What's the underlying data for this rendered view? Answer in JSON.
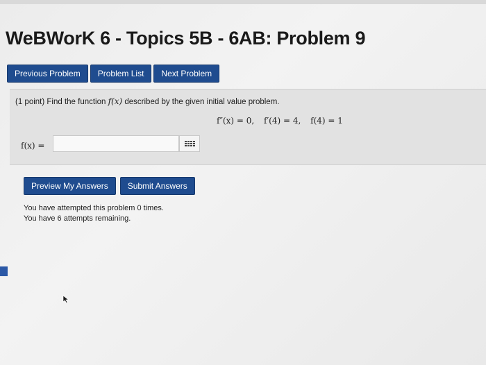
{
  "page": {
    "title": "WeBWorK 6 - Topics 5B - 6AB: Problem 9"
  },
  "nav": {
    "previous_label": "Previous Problem",
    "list_label": "Problem List",
    "next_label": "Next Problem"
  },
  "problem": {
    "intro_before": "(1 point) Find the function ",
    "intro_fx": "f(x)",
    "intro_after": " described by the given initial value problem.",
    "conditions": [
      "f″(x) = 0,",
      "f′(4) = 4,",
      "f(4) = 1"
    ],
    "answer_label": "f(x) =",
    "answer_value": ""
  },
  "actions": {
    "preview_label": "Preview My Answers",
    "submit_label": "Submit Answers"
  },
  "status": {
    "attempted": "You have attempted this problem 0 times.",
    "remaining": "You have 6 attempts remaining."
  },
  "icons": {
    "equation_editor": "grid-icon",
    "cursor": "arrow-cursor-icon"
  },
  "colors": {
    "button_blue": "#1f4c8f",
    "panel_gray": "#e2e2e2"
  }
}
